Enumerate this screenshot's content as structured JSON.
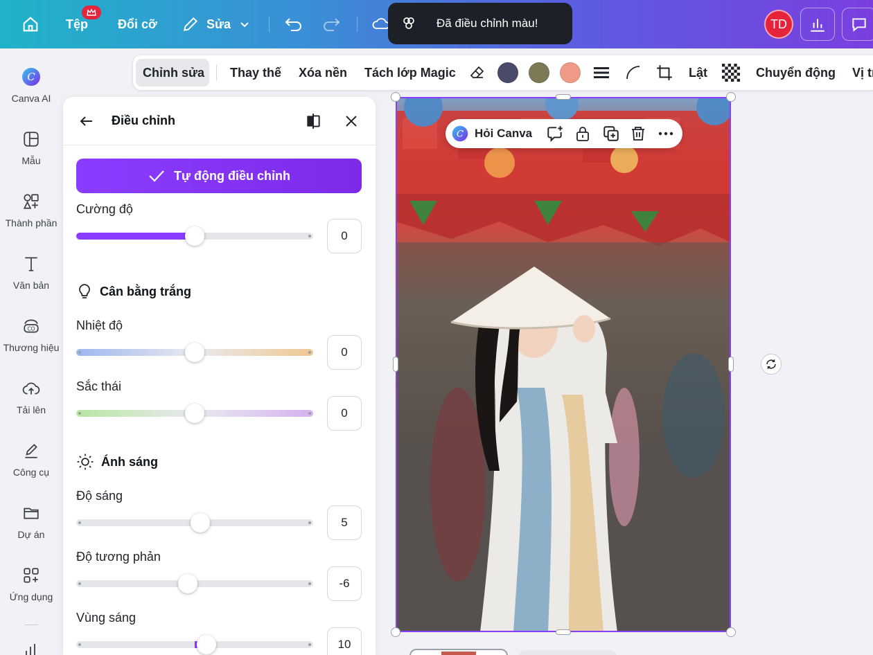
{
  "topbar": {
    "home_icon": "home-icon",
    "file_label": "Tệp",
    "resize_label": "Đổi cỡ",
    "edit_label": "Sửa",
    "avatar_initials": "TD",
    "gradient_start": "#1fb3c8",
    "gradient_end": "#7a3fe0"
  },
  "toast": {
    "text": "Đã điều chỉnh màu!"
  },
  "rail": {
    "items": [
      {
        "label": "Canva AI",
        "icon": "canva-ai-icon"
      },
      {
        "label": "Mẫu",
        "icon": "template-icon"
      },
      {
        "label": "Thành phần",
        "icon": "elements-icon"
      },
      {
        "label": "Văn bản",
        "icon": "text-icon"
      },
      {
        "label": "Thương hiệu",
        "icon": "brand-icon"
      },
      {
        "label": "Tải lên",
        "icon": "upload-icon"
      },
      {
        "label": "Công cụ",
        "icon": "tools-icon"
      },
      {
        "label": "Dự án",
        "icon": "folder-icon"
      },
      {
        "label": "Ứng dụng",
        "icon": "apps-icon"
      }
    ]
  },
  "context_toolbar": {
    "edit": "Chỉnh sửa",
    "replace": "Thay thế",
    "remove_bg": "Xóa nền",
    "magic_layer": "Tách lớp Magic",
    "swatches": [
      "#4a4a6a",
      "#7b7a55",
      "#ef9a86"
    ],
    "flip": "Lật",
    "animate": "Chuyển động",
    "position": "Vị trí"
  },
  "panel": {
    "title": "Điều chỉnh",
    "auto_adjust": "Tự động điều chỉnh",
    "intensity_label": "Cường độ",
    "intensity_value": "0",
    "white_balance_title": "Cân bằng trắng",
    "temperature_label": "Nhiệt độ",
    "temperature_value": "0",
    "tint_label": "Sắc thái",
    "tint_value": "0",
    "light_title": "Ánh sáng",
    "brightness_label": "Độ sáng",
    "brightness_value": "5",
    "contrast_label": "Độ tương phản",
    "contrast_value": "-6",
    "highlights_label": "Vùng sáng",
    "highlights_value": "10",
    "accent": "#8b3dff"
  },
  "float_toolbar": {
    "ask_canva": "Hỏi Canva"
  }
}
